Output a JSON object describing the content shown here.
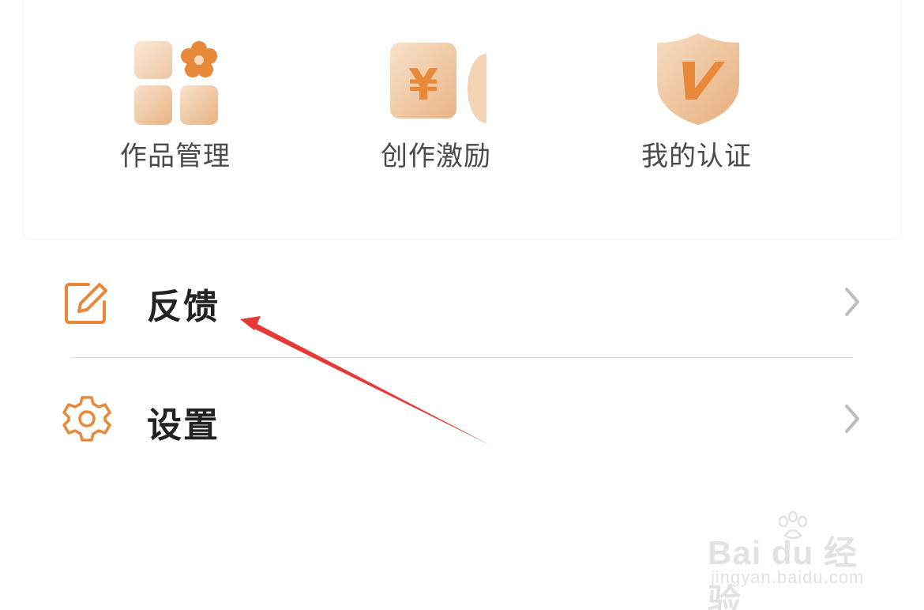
{
  "shortcuts": [
    {
      "label": "作品管理",
      "icon": "works-grid-icon"
    },
    {
      "label": "创作激励",
      "icon": "yuan-coin-icon"
    },
    {
      "label": "我的认证",
      "icon": "verified-shield-icon"
    }
  ],
  "menu": [
    {
      "label": "反馈",
      "icon": "edit-icon"
    },
    {
      "label": "设置",
      "icon": "gear-icon"
    }
  ],
  "icon_yuan_glyph": "¥",
  "colors": {
    "accent": "#E8893A",
    "tile_light": "#F6DCC2",
    "tile_mid": "#E9B786",
    "chevron": "#BDBDBD",
    "annotation_arrow": "#E53935"
  },
  "watermark": {
    "brand": "Bai du 经验",
    "url": "jingyan.baidu.com"
  }
}
